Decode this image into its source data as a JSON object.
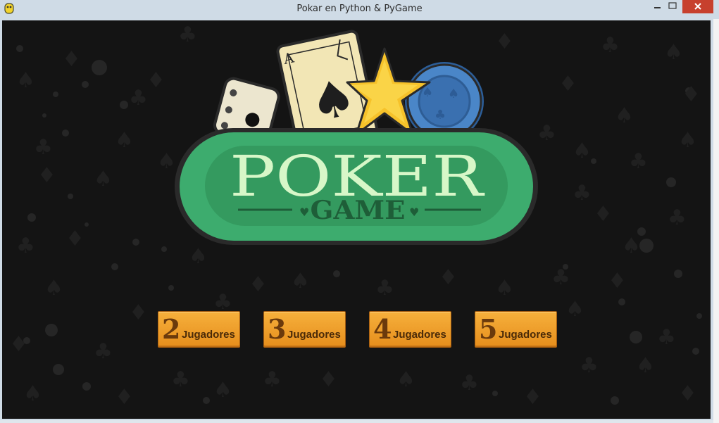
{
  "window": {
    "title": "Pokar en Python & PyGame"
  },
  "logo": {
    "title": "POKER",
    "subtitle": "GAME",
    "card_rank": "A"
  },
  "menu": {
    "buttons": [
      {
        "number": "2",
        "label": "Jugadores"
      },
      {
        "number": "3",
        "label": "Jugadores"
      },
      {
        "number": "4",
        "label": "Jugadores"
      },
      {
        "number": "5",
        "label": "Jugadores"
      }
    ]
  },
  "colors": {
    "background": "#141414",
    "logo_green": "#3dac6e",
    "logo_text": "#d7f7c8",
    "button_orange": "#f0a030",
    "close_red": "#c7402d"
  }
}
